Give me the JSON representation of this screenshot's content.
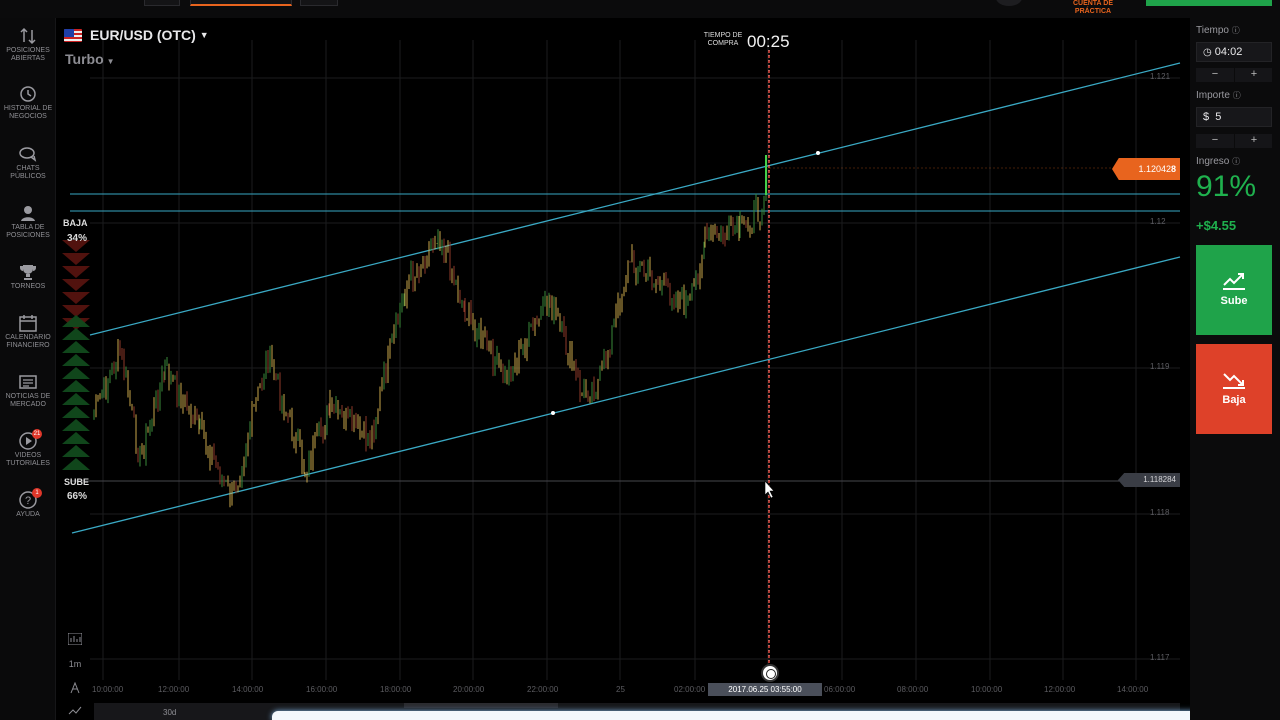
{
  "topbar": {
    "practice_label": "CUENTA DE PRÁCTICA"
  },
  "sidebar": {
    "items": [
      {
        "icon": "swap-icon",
        "label": "POSICIONES ABIERTAS"
      },
      {
        "icon": "history-icon",
        "label": "HISTORIAL DE NEGOCIOS"
      },
      {
        "icon": "chat-icon",
        "label": "CHATS PÚBLICOS"
      },
      {
        "icon": "leaderboard-icon",
        "label": "TABLA DE POSICIONES"
      },
      {
        "icon": "trophy-icon",
        "label": "TORNEOS"
      },
      {
        "icon": "calendar-icon",
        "label": "CALENDARIO FINANCIERO"
      },
      {
        "icon": "news-icon",
        "label": "NOTICIAS DE MERCADO"
      },
      {
        "icon": "video-icon",
        "label": "VIDEOS TUTORIALES",
        "badge": "21"
      },
      {
        "icon": "help-icon",
        "label": "AYUDA",
        "badge": "1"
      }
    ]
  },
  "asset": {
    "name": "EUR/USD (OTC)",
    "mode": "Turbo"
  },
  "countdown": {
    "label": "TIEMPO DE COMPRA",
    "value": "00:25"
  },
  "sentiment": {
    "baja_label": "BAJA",
    "baja_pct": "34%",
    "sube_label": "SUBE",
    "sube_pct": "66%"
  },
  "prices": {
    "current": "1.12042",
    "current_last_digit": "8",
    "target": "1.118284",
    "y_ticks": [
      "1.121",
      "1.12",
      "1.119",
      "1.118",
      "1.117"
    ]
  },
  "x_axis": {
    "ticks": [
      "10:00:00",
      "12:00:00",
      "14:00:00",
      "16:00:00",
      "18:00:00",
      "20:00:00",
      "22:00:00",
      "25",
      "02:00:00",
      "06:00:00",
      "08:00:00",
      "10:00:00",
      "12:00:00",
      "14:00:00"
    ],
    "cursor_label": "2017.06.25 03:55:00"
  },
  "tools": {
    "timeframe": "1m",
    "period": "30d"
  },
  "panel": {
    "time_label": "Tiempo",
    "time_value": "04:02",
    "amount_label": "Importe",
    "amount_currency": "$",
    "amount_value": "5",
    "minus": "−",
    "plus": "+",
    "income_label": "Ingreso",
    "income_pct": "91%",
    "income_amount": "+$4.55",
    "up_label": "Sube",
    "down_label": "Baja"
  },
  "colors": {
    "up": "#1fa34a",
    "down": "#de4129",
    "accent": "#e8641e",
    "trendline": "#3aa9c4"
  }
}
